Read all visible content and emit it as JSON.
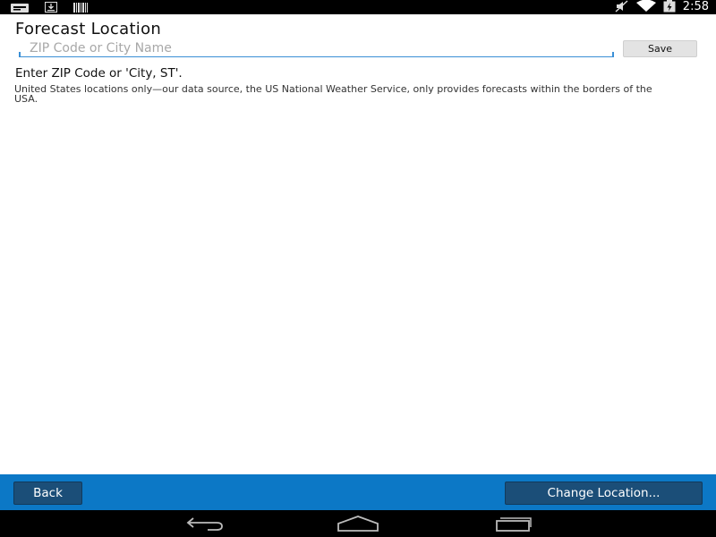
{
  "status_bar": {
    "time": "2:58",
    "left_icons": [
      "notification-icon",
      "download-icon",
      "barcode-icon"
    ],
    "right_icons": [
      "mute-icon",
      "wifi-icon",
      "battery-icon"
    ]
  },
  "screen": {
    "title": "Forecast Location",
    "search": {
      "placeholder": "ZIP Code or City Name",
      "value": ""
    },
    "save_label": "Save",
    "instruction": "Enter ZIP Code or 'City, ST'.",
    "note": "United States locations only—our data source, the US National Weather Service, only provides forecasts within the borders of the USA."
  },
  "bottom_bar": {
    "back_label": "Back",
    "change_location_label": "Change Location..."
  },
  "nav_bar": {
    "icons": [
      "back-nav-icon",
      "home-nav-icon",
      "recents-nav-icon"
    ]
  }
}
